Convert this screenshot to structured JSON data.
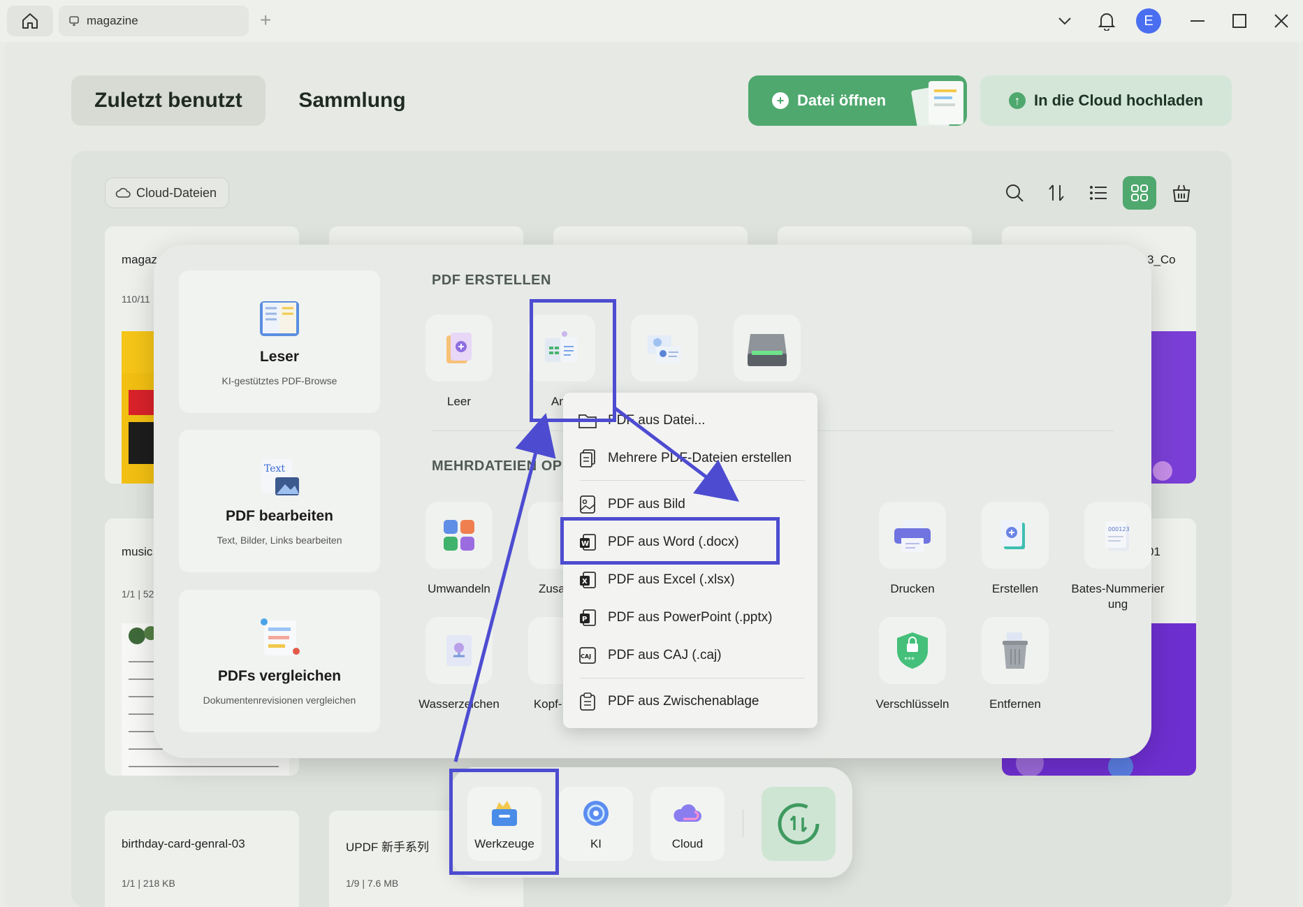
{
  "titlebar": {
    "tab_label": "magazine",
    "avatar_letter": "E"
  },
  "header": {
    "tab_recent": "Zuletzt benutzt",
    "tab_collection": "Sammlung",
    "open_file": "Datei öffnen",
    "upload_cloud": "In die Cloud hochladen"
  },
  "files": {
    "cloud_chip": "Cloud-Dateien",
    "cards": [
      {
        "title": "magaz",
        "meta": "110/11"
      },
      {
        "title": "",
        "meta": ""
      },
      {
        "title": "",
        "meta": ""
      },
      {
        "title": "",
        "meta": ""
      },
      {
        "title": "3_Co",
        "meta": ""
      },
      {
        "title": "music",
        "meta": "1/1 | 52"
      },
      {
        "title": "01",
        "meta": ""
      },
      {
        "title": "birthday-card-genral-03",
        "meta": "1/1 | 218 KB"
      },
      {
        "title": "UPDF 新手系列",
        "meta": "1/9 | 7.6 MB"
      }
    ]
  },
  "overlay": {
    "left_cards": [
      {
        "title": "Leser",
        "subtitle": "KI-gestütztes PDF-Browse"
      },
      {
        "title": "PDF bearbeiten",
        "subtitle": "Text, Bilder, Links bearbeiten"
      },
      {
        "title": "PDFs vergleichen",
        "subtitle": "Dokumentenrevisionen vergleichen"
      }
    ],
    "section_create": "PDF ERSTELLEN",
    "section_multi": "MEHRDATEIEN OPE",
    "create_tools": [
      {
        "label": "Leer"
      },
      {
        "label": "And"
      },
      {
        "label": ""
      },
      {
        "label": ""
      }
    ],
    "multi_tools": [
      {
        "label": "Umwandeln"
      },
      {
        "label": "Zusamm"
      },
      {
        "label": "Drucken"
      },
      {
        "label": "Erstellen"
      },
      {
        "label": "Bates-Nummerier ung"
      },
      {
        "label": "Wasserzeichen"
      },
      {
        "label": "Kopf- Fuß."
      },
      {
        "label": "Verschlüsseln"
      },
      {
        "label": "Entfernen"
      }
    ]
  },
  "menu": {
    "items": [
      "PDF aus Datei...",
      "Mehrere PDF-Dateien erstellen",
      "PDF aus Bild",
      "PDF aus Word (.docx)",
      "PDF aus Excel (.xlsx)",
      "PDF aus PowerPoint (.pptx)",
      "PDF aus CAJ (.caj)",
      "PDF aus Zwischenablage"
    ]
  },
  "dock": {
    "tools": "Werkzeuge",
    "ai": "KI",
    "cloud": "Cloud"
  },
  "colors": {
    "accent_green": "#4fa86e",
    "annotation_blue": "#4d4cd1",
    "avatar_blue": "#4a6ef0"
  }
}
